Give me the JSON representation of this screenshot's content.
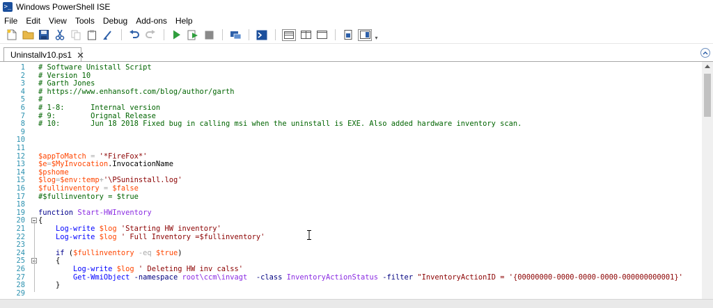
{
  "window": {
    "title": "Windows PowerShell ISE",
    "icon": "powershell-icon"
  },
  "menu": [
    "File",
    "Edit",
    "View",
    "Tools",
    "Debug",
    "Add-ons",
    "Help"
  ],
  "toolbar": {
    "icons": [
      "new-file-icon",
      "open-folder-icon",
      "save-icon",
      "cut-icon",
      "copy-icon",
      "paste-icon",
      "clear-console-icon",
      "undo-icon",
      "redo-icon",
      "run-icon",
      "run-selection-icon",
      "stop-icon",
      "new-remote-tab-icon",
      "start-powershell-icon",
      "show-script-pane-top-icon",
      "show-script-pane-right-icon",
      "show-script-pane-maximized-icon",
      "show-command-window-icon",
      "show-command-addon-icon"
    ]
  },
  "tab": {
    "label": "Uninstallv10.ps1",
    "close": "✕"
  },
  "colors": {
    "line_number": "#2b91af",
    "comment": "#006400",
    "variable": "#ff4500",
    "string": "#8b0000",
    "keyword": "#00008b",
    "command": "#0000ff"
  },
  "code_lines": [
    {
      "n": "1",
      "tokens": [
        [
          "c-comment",
          "# Software Unistall Script"
        ]
      ]
    },
    {
      "n": "2",
      "tokens": [
        [
          "c-comment",
          "# Version 10"
        ]
      ]
    },
    {
      "n": "3",
      "tokens": [
        [
          "c-comment",
          "# Garth Jones"
        ]
      ]
    },
    {
      "n": "4",
      "tokens": [
        [
          "c-comment",
          "# https://www.enhansoft.com/blog/author/garth"
        ]
      ]
    },
    {
      "n": "5",
      "tokens": [
        [
          "c-comment",
          "#"
        ]
      ]
    },
    {
      "n": "6",
      "tokens": [
        [
          "c-comment",
          "# 1-8:      Internal version"
        ]
      ]
    },
    {
      "n": "7",
      "tokens": [
        [
          "c-comment",
          "# 9:        Orignal Release"
        ]
      ]
    },
    {
      "n": "8",
      "tokens": [
        [
          "c-comment",
          "# 10:       Jun 18 2018 Fixed bug in calling msi when the uninstall is EXE. Also added hardware inventory scan."
        ]
      ]
    },
    {
      "n": "9",
      "tokens": []
    },
    {
      "n": "10",
      "tokens": []
    },
    {
      "n": "11",
      "tokens": []
    },
    {
      "n": "12",
      "tokens": [
        [
          "c-var",
          "$appToMatch"
        ],
        [
          "c-op",
          " = "
        ],
        [
          "c-str",
          "'*FireFox*'"
        ]
      ]
    },
    {
      "n": "13",
      "tokens": [
        [
          "c-var",
          "$e"
        ],
        [
          "c-op",
          "="
        ],
        [
          "c-var",
          "$MyInvocation"
        ],
        [
          "c-plain",
          ".InvocationName"
        ]
      ]
    },
    {
      "n": "14",
      "tokens": [
        [
          "c-var",
          "$pshome"
        ]
      ]
    },
    {
      "n": "15",
      "tokens": [
        [
          "c-var",
          "$log"
        ],
        [
          "c-op",
          "="
        ],
        [
          "c-var",
          "$env:temp"
        ],
        [
          "c-op",
          "+"
        ],
        [
          "c-str",
          "'\\PSuninstall.log'"
        ]
      ]
    },
    {
      "n": "16",
      "tokens": [
        [
          "c-var",
          "$fullinventory"
        ],
        [
          "c-op",
          " = "
        ],
        [
          "c-var",
          "$false"
        ]
      ]
    },
    {
      "n": "17",
      "tokens": [
        [
          "c-comment",
          "#$fullinventory = $true"
        ]
      ]
    },
    {
      "n": "18",
      "tokens": []
    },
    {
      "n": "19",
      "tokens": [
        [
          "c-kw",
          "function "
        ],
        [
          "c-type",
          "Start-HWInventory"
        ]
      ]
    },
    {
      "n": "20",
      "fold": true,
      "tokens": [
        [
          "c-plain",
          "{"
        ]
      ]
    },
    {
      "n": "21",
      "tokens": [
        [
          "c-plain",
          "    "
        ],
        [
          "c-cmd",
          "Log-write"
        ],
        [
          "c-plain",
          " "
        ],
        [
          "c-var",
          "$log"
        ],
        [
          "c-plain",
          " "
        ],
        [
          "c-str",
          "'Starting HW inventory'"
        ]
      ]
    },
    {
      "n": "22",
      "tokens": [
        [
          "c-plain",
          "    "
        ],
        [
          "c-cmd",
          "Log-write"
        ],
        [
          "c-plain",
          " "
        ],
        [
          "c-var",
          "$log"
        ],
        [
          "c-plain",
          " "
        ],
        [
          "c-str",
          "' Full Inventory =$fullinventory'"
        ]
      ]
    },
    {
      "n": "23",
      "tokens": []
    },
    {
      "n": "24",
      "tokens": [
        [
          "c-plain",
          "    "
        ],
        [
          "c-kw",
          "if"
        ],
        [
          "c-plain",
          " ("
        ],
        [
          "c-var",
          "$fullinventory"
        ],
        [
          "c-plain",
          " "
        ],
        [
          "c-op",
          "-eq"
        ],
        [
          "c-plain",
          " "
        ],
        [
          "c-var",
          "$true"
        ],
        [
          "c-plain",
          ")"
        ]
      ]
    },
    {
      "n": "25",
      "fold": true,
      "tokens": [
        [
          "c-plain",
          "    {"
        ]
      ]
    },
    {
      "n": "26",
      "tokens": [
        [
          "c-plain",
          "        "
        ],
        [
          "c-cmd",
          "Log-write"
        ],
        [
          "c-plain",
          " "
        ],
        [
          "c-var",
          "$log"
        ],
        [
          "c-plain",
          " "
        ],
        [
          "c-str",
          "' Deleting HW inv calss'"
        ]
      ]
    },
    {
      "n": "27",
      "tokens": [
        [
          "c-plain",
          "        "
        ],
        [
          "c-cmd",
          "Get-WmiObject"
        ],
        [
          "c-plain",
          " "
        ],
        [
          "c-param",
          "-namespace"
        ],
        [
          "c-plain",
          " "
        ],
        [
          "c-type",
          "root\\ccm\\invagt"
        ],
        [
          "c-plain",
          "  "
        ],
        [
          "c-param",
          "-class"
        ],
        [
          "c-plain",
          " "
        ],
        [
          "c-type",
          "InventoryActionStatus"
        ],
        [
          "c-plain",
          " "
        ],
        [
          "c-param",
          "-filter"
        ],
        [
          "c-plain",
          " "
        ],
        [
          "c-str",
          "\"InventoryActionID = '{00000000-0000-0000-0000-000000000001}'"
        ]
      ]
    },
    {
      "n": "28",
      "tokens": [
        [
          "c-plain",
          "    }"
        ]
      ]
    },
    {
      "n": "29",
      "tokens": []
    }
  ]
}
